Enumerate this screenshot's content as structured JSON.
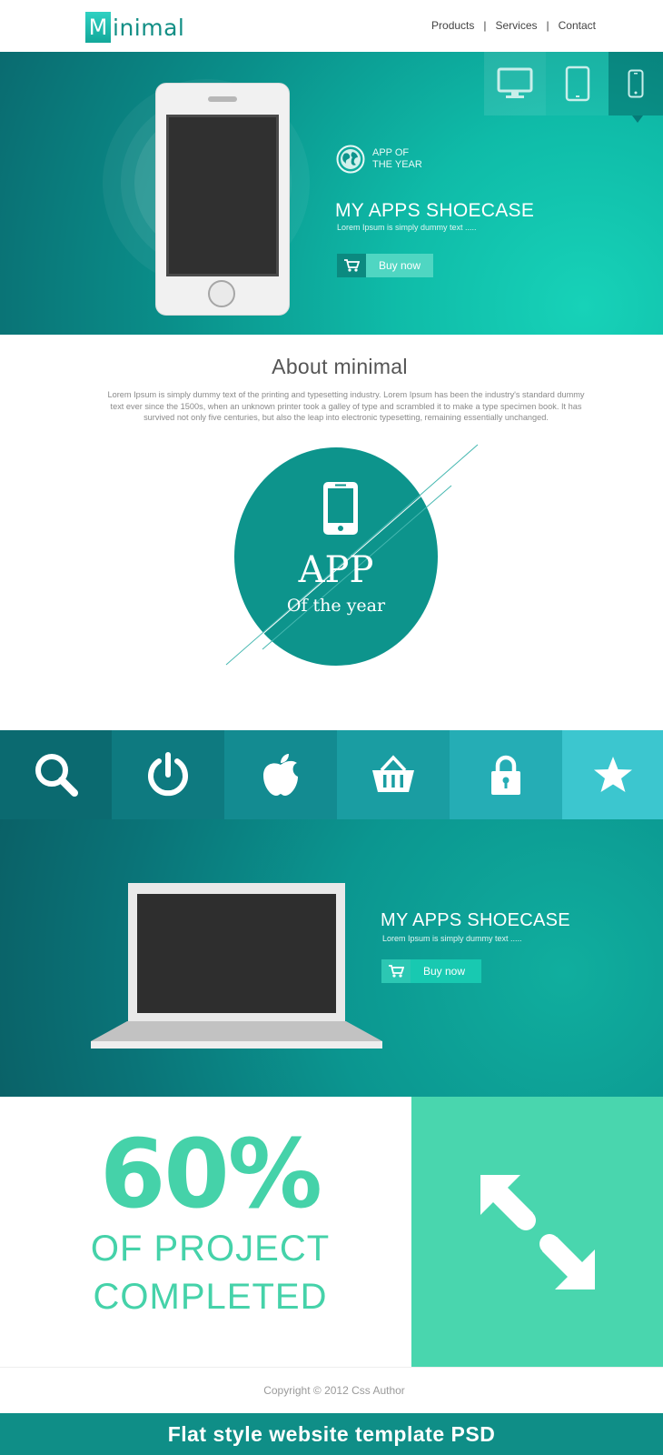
{
  "header": {
    "logo_letter": "M",
    "logo_rest": "inimal",
    "nav": [
      "Products",
      "Services",
      "Contact"
    ],
    "nav_separator": "|"
  },
  "hero": {
    "device_tabs": [
      "desktop-icon",
      "tablet-icon",
      "phone-icon"
    ],
    "award_line1": "APP OF",
    "award_line2": "THE YEAR",
    "title": "MY APPS SHOECASE",
    "subtitle": "Lorem Ipsum is simply dummy text .....",
    "buy_label": "Buy now"
  },
  "about": {
    "title": "About minimal",
    "text": "Lorem Ipsum is simply dummy text of the printing and typesetting industry. Lorem Ipsum has been the industry's standard dummy text ever since the 1500s, when an unknown printer took a galley of type and scrambled it to make a type specimen book. It has survived not only five centuries, but also the leap into electronic typesetting, remaining essentially unchanged."
  },
  "badge": {
    "line1": "APP",
    "line2": "Of the year"
  },
  "icon_strip": {
    "items": [
      "search-icon",
      "power-icon",
      "apple-icon",
      "basket-icon",
      "lock-icon",
      "star-icon"
    ],
    "colors": [
      "#0b6a70",
      "#0e7a80",
      "#138b91",
      "#1a9da2",
      "#25adb5",
      "#3cc6cf"
    ]
  },
  "laptop_section": {
    "title": "MY APPS SHOECASE",
    "subtitle": "Lorem Ipsum is simply dummy text .....",
    "buy_label": "Buy now"
  },
  "stats": {
    "percent": "60%",
    "line1": "OF PROJECT",
    "line2": "COMPLETED"
  },
  "footer": {
    "copyright": "Copyright © 2012 Css Author",
    "banner": "Flat style  website template PSD"
  },
  "colors": {
    "accent": "#0d948c",
    "mint": "#49d6ae",
    "banner": "#0f8e87"
  }
}
